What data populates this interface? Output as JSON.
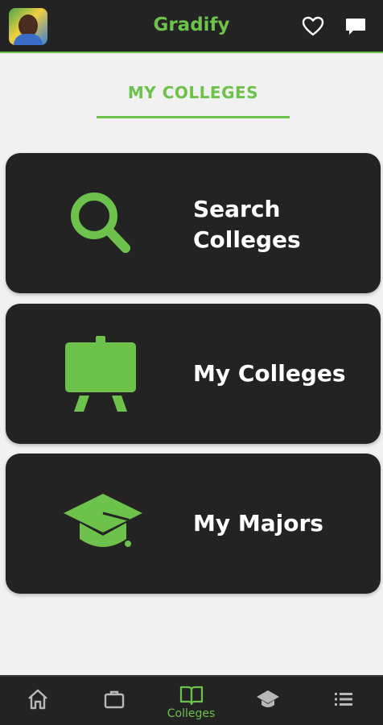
{
  "header": {
    "title": "Gradify",
    "avatar_icon": "profile-photo",
    "favorites_icon": "heart-icon",
    "messages_icon": "chat-bubble-icon"
  },
  "section": {
    "title": "MY COLLEGES"
  },
  "cards": [
    {
      "label": "Search\nColleges",
      "icon": "magnifier-icon"
    },
    {
      "label": "My Colleges",
      "icon": "easel-board-icon"
    },
    {
      "label": "My Majors",
      "icon": "graduation-cap-icon"
    }
  ],
  "bottom_nav": {
    "items": [
      {
        "icon": "home-icon",
        "label": ""
      },
      {
        "icon": "briefcase-icon",
        "label": ""
      },
      {
        "icon": "open-book-icon",
        "label": "Colleges",
        "active": true
      },
      {
        "icon": "graduation-cap-icon",
        "label": ""
      },
      {
        "icon": "list-icon",
        "label": ""
      }
    ]
  },
  "colors": {
    "accent": "#6cc24a",
    "bar_background": "#232323",
    "page_background": "#f1f1f1",
    "card_text": "#ffffff",
    "inactive_icon": "#b8b8b8"
  }
}
